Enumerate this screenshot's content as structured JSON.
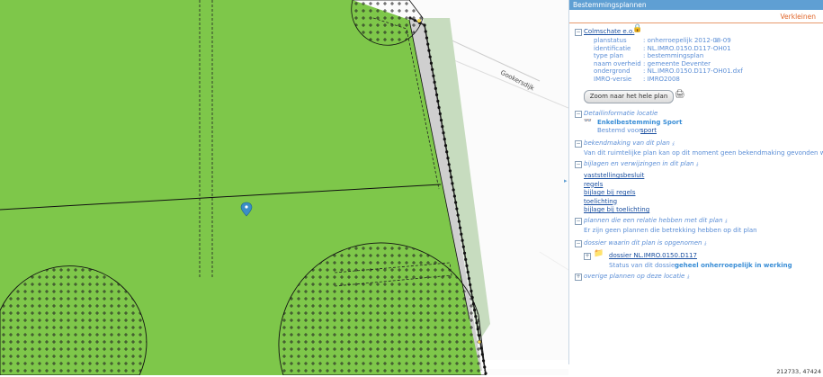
{
  "map": {
    "street_label": "Gookersdijk",
    "coords": "212733, 47424"
  },
  "panel": {
    "title": "Bestemmingsplannen",
    "collapse_label": "Verkleinen",
    "plan": {
      "name": "Colmschate e.o.",
      "rows": [
        {
          "label": "planstatus",
          "value": ": onherroepelijk 2012-08-09"
        },
        {
          "label": "identificatie",
          "value": ": NL.IMRO.0150.D117-OH01"
        },
        {
          "label": "type plan",
          "value": ": bestemmingsplan"
        },
        {
          "label": "naam overheid",
          "value": ": gemeente Deventer"
        },
        {
          "label": "ondergrond",
          "value": ": NL.IMRO.0150.D117-OH01.dxf"
        },
        {
          "label": "IMRO-versie",
          "value": ": IMRO2008"
        }
      ],
      "zoom_button": "Zoom naar het hele plan"
    },
    "detail": {
      "heading": "Detailinformatie locatie",
      "item_title": "Enkelbestemming Sport",
      "item_prefix": "Bestemd voor:",
      "item_link": "sport"
    },
    "bekendmaking": {
      "heading": "bekendmaking van dit plan",
      "text": "Van dit ruimtelijke plan kan op dit moment geen bekendmaking gevonden worden"
    },
    "bijlagen": {
      "heading": "bijlagen en verwijzingen in dit plan",
      "links": [
        "vaststellingsbesluit",
        "regels",
        "bijlage bij regels",
        "toelichting",
        "bijlage bij toelichting"
      ]
    },
    "relatie": {
      "heading": "plannen die een relatie hebben met dit plan",
      "text": "Er zijn geen plannen die betrekking hebben op dit plan"
    },
    "dossier": {
      "heading": "dossier waarin dit plan is opgenomen",
      "link": "dossier NL.IMRO.0150.D117",
      "status_prefix": "Status van dit dossier:",
      "status_value": "geheel onherroepelijk in werking"
    },
    "overige": {
      "heading": "overige plannen op deze locatie"
    }
  },
  "colors": {
    "green": "#7ec74a",
    "panel_header": "#5f9fd3",
    "link": "#1a4fa0",
    "accent": "#e0662a"
  }
}
